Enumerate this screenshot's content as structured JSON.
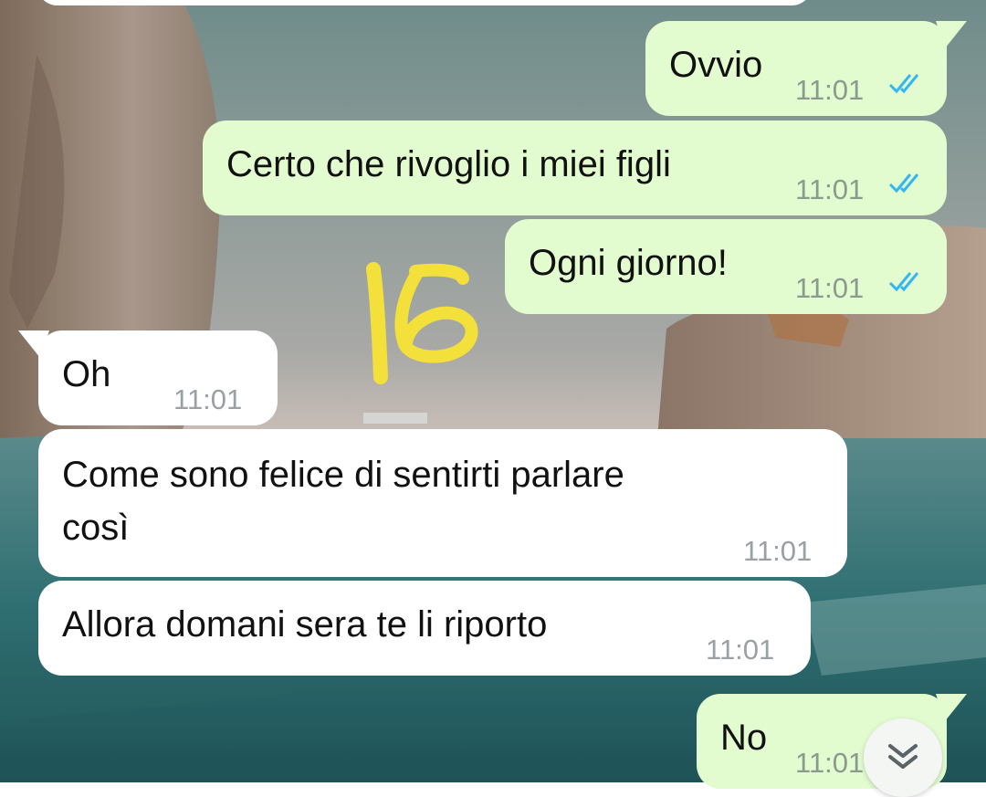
{
  "messages": [
    {
      "id": "m1",
      "direction": "outgoing",
      "text": "Ovvio",
      "time": "11:01",
      "status": "read"
    },
    {
      "id": "m2",
      "direction": "outgoing",
      "text": "Certo che rivoglio i miei figli",
      "time": "11:01",
      "status": "read"
    },
    {
      "id": "m3",
      "direction": "outgoing",
      "text": "Ogni giorno!",
      "time": "11:01",
      "status": "read"
    },
    {
      "id": "m4",
      "direction": "incoming",
      "text": "Oh",
      "time": "11:01"
    },
    {
      "id": "m5",
      "direction": "incoming",
      "text_line1": "Come sono felice di sentirti parlare",
      "text_line2": "così",
      "time": "11:01"
    },
    {
      "id": "m6",
      "direction": "incoming",
      "text": "Allora domani sera te li riporto",
      "time": "11:01"
    },
    {
      "id": "m7",
      "direction": "outgoing",
      "text": "No",
      "time": "11:01",
      "status": "read"
    }
  ],
  "annotation": {
    "text": "16",
    "color": "#f3e03a"
  },
  "colors": {
    "outgoing_bubble": "#e2fbcf",
    "incoming_bubble": "#ffffff",
    "read_ticks": "#34b7f1",
    "timestamp": "#8b9a8f"
  },
  "icons": {
    "read_receipt": "double-check-icon",
    "scroll_down": "chevron-double-down-icon"
  }
}
